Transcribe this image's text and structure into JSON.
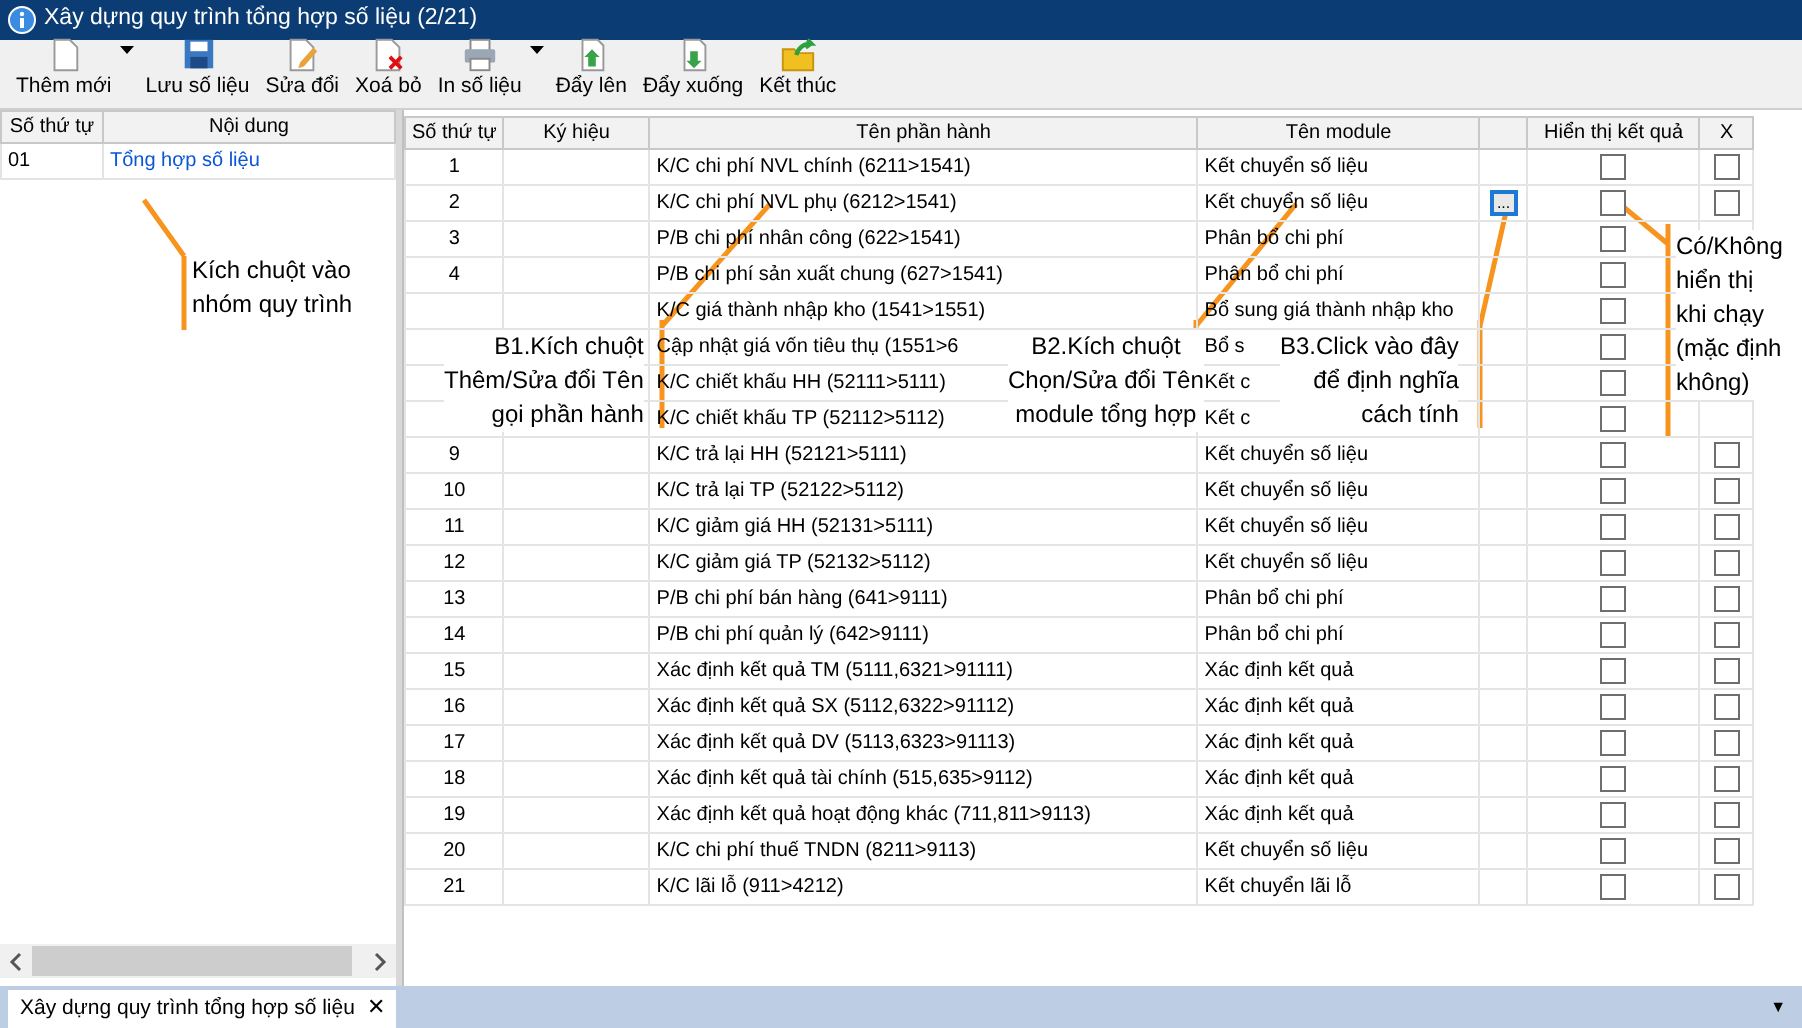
{
  "window": {
    "title": "Xây dựng quy trình tổng hợp số liệu (2/21)"
  },
  "toolbar": {
    "buttons": [
      {
        "label": "Thêm mới",
        "dropdown": true
      },
      {
        "label": "Lưu số liệu",
        "dropdown": false
      },
      {
        "label": "Sửa đổi",
        "dropdown": false
      },
      {
        "label": "Xoá bỏ",
        "dropdown": false
      },
      {
        "label": "In số liệu",
        "dropdown": true
      },
      {
        "label": "Đẩy lên",
        "dropdown": false
      },
      {
        "label": "Đẩy xuống",
        "dropdown": false
      },
      {
        "label": "Kết thúc",
        "dropdown": false
      }
    ]
  },
  "group_list": {
    "columns": [
      "Số thứ tự",
      "Nội dung"
    ],
    "rows": [
      {
        "no": "01",
        "content": "Tổng hợp số liệu",
        "selected": true
      }
    ]
  },
  "table": {
    "columns": [
      "Số thứ tự",
      "Ký hiệu",
      "Tên phần hành",
      "Tên module",
      "Hiển thị kết  quả",
      "X"
    ],
    "rows": [
      {
        "no": "1",
        "name": "K/C chi phí NVL chính (6211>1541)",
        "module": "Kết chuyển số liệu",
        "show_result": false,
        "remove": false
      },
      {
        "no": "2",
        "name": "K/C chi phí NVL phụ (6212>1541)",
        "module": "Kết chuyển số liệu",
        "button": "...",
        "show_result": false,
        "remove": false
      },
      {
        "no": "3",
        "name": "P/B chi phí nhân công (622>1541)",
        "module": "Phân bổ chi phí",
        "show_result": false
      },
      {
        "no": "4",
        "name": "P/B chi phí sản xuất chung (627>1541)",
        "module": "Phân bổ chi phí",
        "show_result": false
      },
      {
        "name": "K/C giá thành nhập kho (1541>1551)",
        "module": "Bổ sung giá thành nhập kho",
        "show_result": false
      },
      {
        "name": "Cập nhật giá vốn tiêu thụ (1551>6",
        "module": "Bổ s",
        "show_result": false
      },
      {
        "name": "K/C chiết khấu HH (52111>5111)",
        "module": "Kết c",
        "show_result": false
      },
      {
        "name": "K/C chiết khấu TP (52112>5112)",
        "module": "Kết c",
        "show_result": false
      },
      {
        "no": "9",
        "name": "K/C trả lại HH (52121>5111)",
        "module": "Kết chuyển số liệu",
        "show_result": false,
        "remove": false
      },
      {
        "no": "10",
        "name": "K/C trả lại TP (52122>5112)",
        "module": "Kết chuyển số liệu",
        "show_result": false,
        "remove": false
      },
      {
        "no": "11",
        "name": "K/C giảm giá HH (52131>5111)",
        "module": "Kết chuyển số liệu",
        "show_result": false,
        "remove": false
      },
      {
        "no": "12",
        "name": "K/C giảm giá TP (52132>5112)",
        "module": "Kết chuyển số liệu",
        "show_result": false,
        "remove": false
      },
      {
        "no": "13",
        "name": "P/B chi phí bán hàng (641>9111)",
        "module": "Phân bổ chi phí",
        "show_result": false,
        "remove": false
      },
      {
        "no": "14",
        "name": "P/B chi phí quản lý (642>9111)",
        "module": "Phân bổ chi phí",
        "show_result": false,
        "remove": false
      },
      {
        "no": "15",
        "name": "Xác định kết quả TM (5111,6321>91111)",
        "module": "Xác định kết quả",
        "show_result": false,
        "remove": false
      },
      {
        "no": "16",
        "name": "Xác định kết quả SX (5112,6322>91112)",
        "module": "Xác định kết quả",
        "show_result": false,
        "remove": false
      },
      {
        "no": "17",
        "name": "Xác định kết quả DV (5113,6323>91113)",
        "module": "Xác định kết quả",
        "show_result": false,
        "remove": false
      },
      {
        "no": "18",
        "name": "Xác định kết quả tài chính (515,635>9112)",
        "module": "Xác định kết quả",
        "show_result": false,
        "remove": false
      },
      {
        "no": "19",
        "name": "Xác định kết quả hoạt động khác (711,811>9113)",
        "module": "Xác định kết quả",
        "show_result": false,
        "remove": false
      },
      {
        "no": "20",
        "name": "K/C chi phí thuế TNDN (8211>9113)",
        "module": "Kết chuyển số liệu",
        "show_result": false,
        "remove": false
      },
      {
        "no": "21",
        "name": "K/C lãi lỗ (911>4212)",
        "module": "Kết chuyển lãi lỗ",
        "show_result": false,
        "remove": false
      }
    ]
  },
  "annotations": [
    {
      "lines": [
        "Kích chuột vào",
        "nhóm quy trình"
      ]
    },
    {
      "lines": [
        "B1.Kích chuột",
        "Thêm/Sửa đổi Tên",
        "gọi phần hành"
      ]
    },
    {
      "lines": [
        "B2.Kích chuột",
        "Chọn/Sửa đổi Tên",
        "module tổng hợp"
      ]
    },
    {
      "lines": [
        "B3.Click vào đây",
        "để định nghĩa",
        "cách tính"
      ]
    },
    {
      "lines": [
        "Có/Không",
        "hiển thị",
        "khi chạy",
        "(mặc định",
        "không)"
      ]
    }
  ],
  "bottom_tabs": [
    {
      "label": "Xây dựng quy trình tổng hợp số liệu",
      "close": "✕",
      "selected": true
    }
  ],
  "tab_menu": "▼"
}
